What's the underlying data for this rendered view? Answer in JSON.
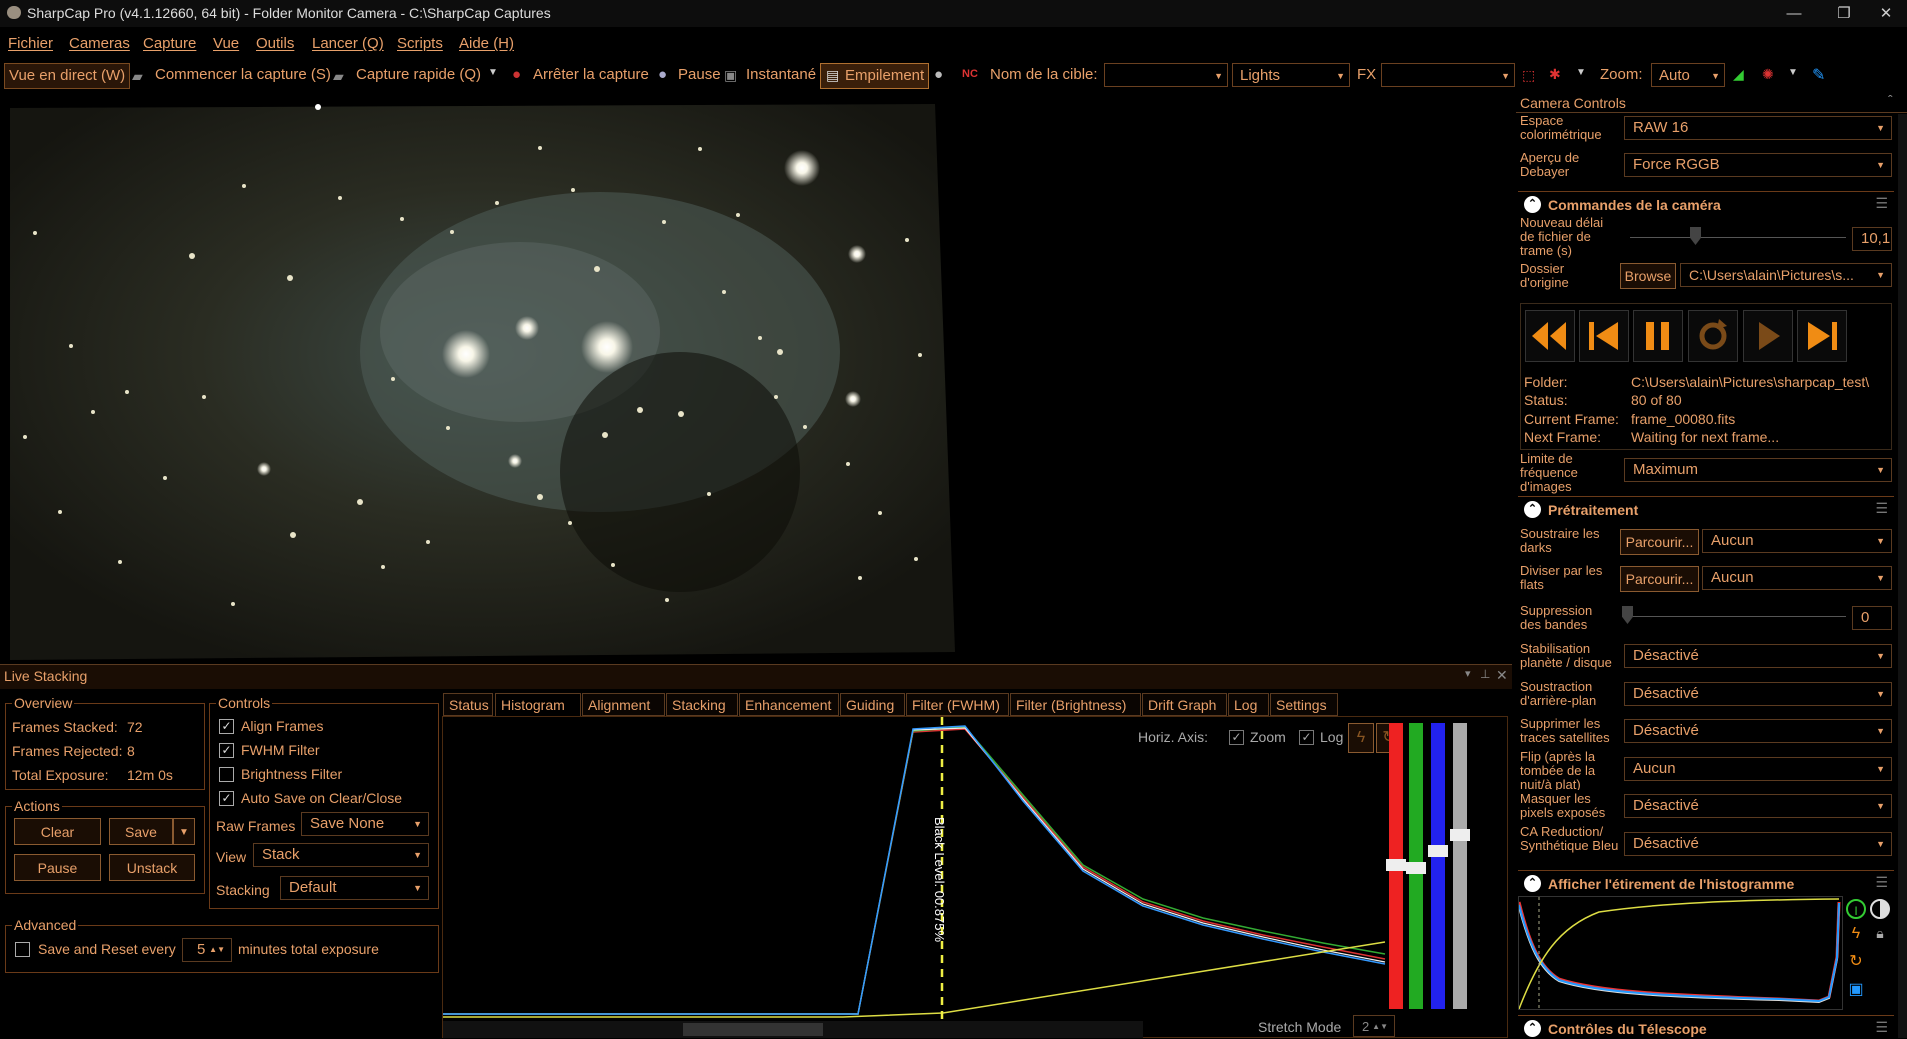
{
  "window": {
    "title": "SharpCap Pro (v4.1.12660, 64 bit) - Folder Monitor Camera - C:\\SharpCap Captures"
  },
  "menu": [
    "Fichier",
    "Cameras",
    "Capture",
    "Vue",
    "Outils",
    "Lancer (Q)",
    "Scripts",
    "Aide (H)"
  ],
  "toolbar": {
    "live_view": "Vue en direct (W)",
    "start_capture": "Commencer la capture (S)",
    "quick_capture": "Capture rapide (Q)",
    "stop_capture": "Arrêter la capture",
    "pause": "Pause",
    "snapshot": "Instantané",
    "stacking": "Empilement",
    "target_label": "Nom de la cible:",
    "target_value": "",
    "frame_type": "Lights",
    "fx_label": "FX",
    "fx_value": "",
    "zoom_label": "Zoom:",
    "zoom_value": "Auto"
  },
  "live_stacking": {
    "title": "Live Stacking",
    "overview": {
      "title": "Overview",
      "frames_stacked_label": "Frames Stacked:",
      "frames_stacked": "72",
      "frames_rejected_label": "Frames Rejected:",
      "frames_rejected": "8",
      "total_exposure_label": "Total Exposure:",
      "total_exposure": "12m 0s"
    },
    "controls": {
      "title": "Controls",
      "align": "Align Frames",
      "fwhm": "FWHM Filter",
      "brightness": "Brightness Filter",
      "autosave": "Auto Save on Clear/Close",
      "raw_frames_label": "Raw Frames",
      "raw_frames": "Save None",
      "view_label": "View",
      "view": "Stack",
      "stacking_label": "Stacking",
      "stacking": "Default"
    },
    "actions": {
      "title": "Actions",
      "clear": "Clear",
      "save": "Save",
      "pause": "Pause",
      "unstack": "Unstack"
    },
    "advanced": {
      "title": "Advanced",
      "save_reset": "Save and Reset every",
      "minutes": "5",
      "minutes_suffix": "minutes total exposure"
    },
    "tabs": [
      "Status",
      "Histogram",
      "Alignment",
      "Stacking",
      "Enhancement",
      "Guiding",
      "Filter (FWHM)",
      "Filter (Brightness)",
      "Drift Graph",
      "Log",
      "Settings"
    ],
    "histogram": {
      "horiz_axis": "Horiz. Axis:",
      "zoom": "Zoom",
      "log": "Log",
      "black_level": "Black Level: 00.875%",
      "stretch_mode": "Stretch Mode",
      "stretch_value": "2"
    }
  },
  "camera_controls": {
    "title": "Camera Controls",
    "colorspace_label": "Espace colorimétrique",
    "colorspace": "RAW 16",
    "debayer_label": "Aperçu de Debayer",
    "debayer": "Force RGGB",
    "commands_title": "Commandes de la caméra",
    "new_delay_label": "Nouveau délai de fichier de trame (s)",
    "new_delay": "10,1",
    "source_label": "Dossier d'origine",
    "browse": "Browse",
    "source_path": "C:\\Users\\alain\\Pictures\\s...",
    "folder_label": "Folder:",
    "folder": "C:\\Users\\alain\\Pictures\\sharpcap_test\\",
    "status_label": "Status:",
    "status": "80 of 80",
    "current_label": "Current Frame:",
    "current": "frame_00080.fits",
    "next_label": "Next Frame:",
    "next": "Waiting for next frame...",
    "fps_label": "Limite de fréquence d'images",
    "fps": "Maximum",
    "preproc_title": "Prétraitement",
    "darks_label": "Soustraire les darks",
    "darks_btn": "Parcourir...",
    "darks": "Aucun",
    "flats_label": "Diviser par les flats",
    "flats_btn": "Parcourir...",
    "flats": "Aucun",
    "banding_label": "Suppression des bandes",
    "banding": "0",
    "stab_label": "Stabilisation planète / disque",
    "stab": "Désactivé",
    "bg_label": "Soustraction d'arrière-plan",
    "bg": "Désactivé",
    "sat_label": "Supprimer les traces satellites",
    "sat": "Désactivé",
    "flip_label": "Flip (après la tombée de la nuit/à plat)",
    "flip": "Aucun",
    "hot_label": "Masquer les pixels exposés",
    "hot": "Désactivé",
    "ca_label": "CA Reduction/ Synthétique Bleu",
    "ca": "Désactivé",
    "histo_title": "Afficher l'étirement de l'histogramme",
    "telescope_title": "Contrôles du Télescope"
  },
  "colors": {
    "accent": "#e8a06a",
    "border": "#7a4a20"
  }
}
